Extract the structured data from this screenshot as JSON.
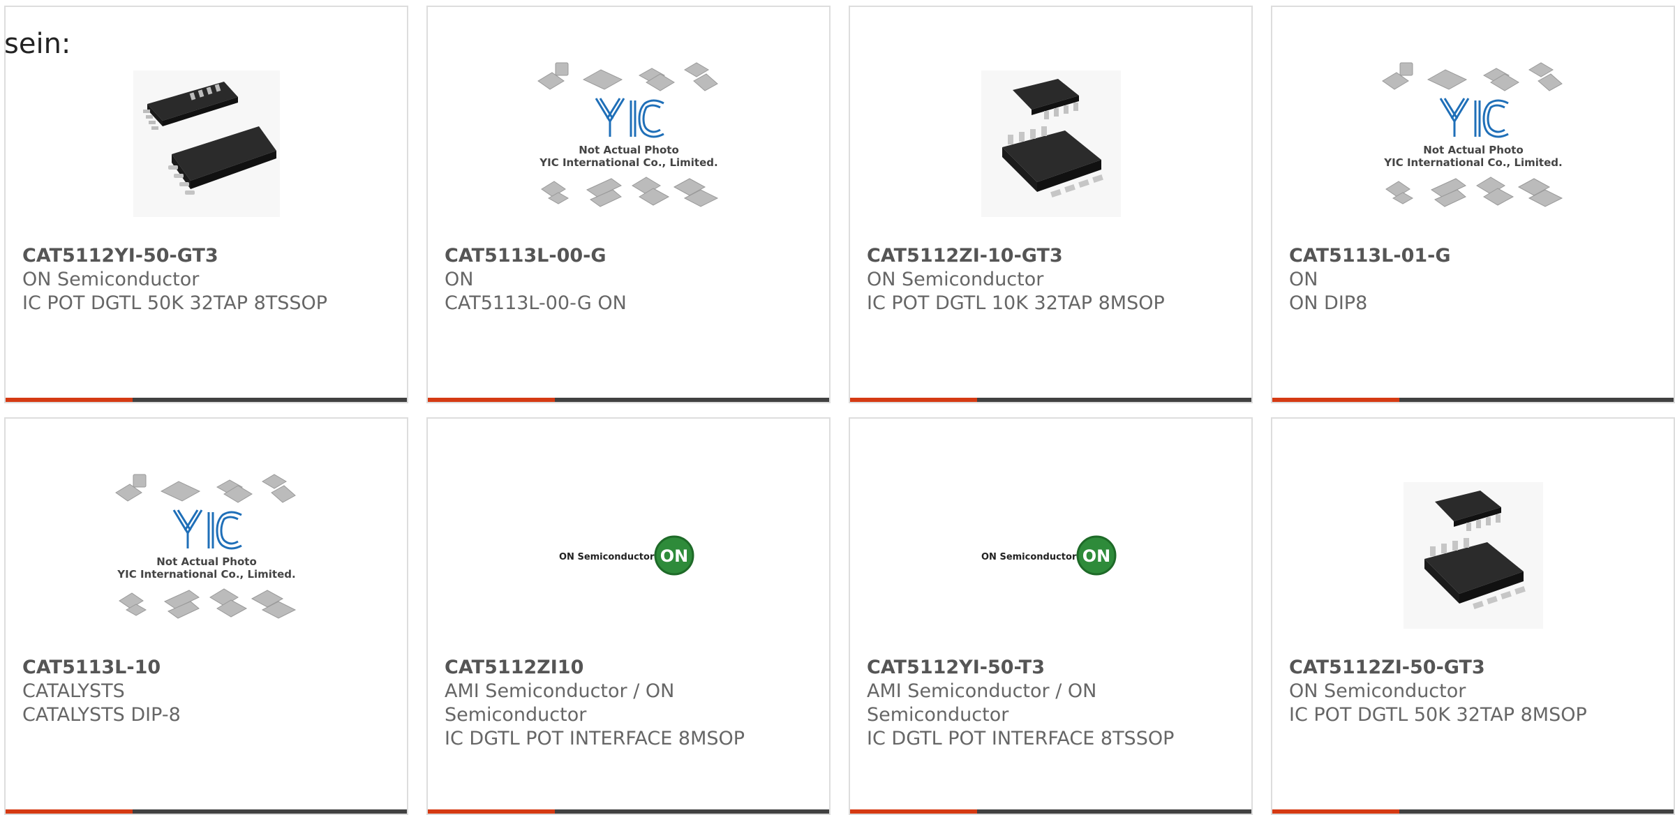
{
  "intro_text": "sein:",
  "products": [
    {
      "part": "CAT5112YI-50-GT3",
      "maker": "ON Semiconductor",
      "desc": "IC POT DGTL 50K 32TAP 8TSSOP",
      "image": "chip-tssop"
    },
    {
      "part": "CAT5113L-00-G",
      "maker": "ON",
      "desc": "CAT5113L-00-G ON",
      "image": "yic-placeholder"
    },
    {
      "part": "CAT5112ZI-10-GT3",
      "maker": "ON Semiconductor",
      "desc": "IC POT DGTL 10K 32TAP 8MSOP",
      "image": "chip-msop"
    },
    {
      "part": "CAT5113L-01-G",
      "maker": "ON",
      "desc": "ON DIP8",
      "image": "yic-placeholder"
    },
    {
      "part": "CAT5113L-10",
      "maker": "CATALYSTS",
      "desc": "CATALYSTS DIP-8",
      "image": "yic-placeholder"
    },
    {
      "part": "CAT5112ZI10",
      "maker": "AMI Semiconductor / ON Semiconductor",
      "desc": "IC DGTL POT INTERFACE 8MSOP",
      "image": "on-logo"
    },
    {
      "part": "CAT5112YI-50-T3",
      "maker": "AMI Semiconductor / ON Semiconductor",
      "desc": "IC DGTL POT INTERFACE 8TSSOP",
      "image": "on-logo"
    },
    {
      "part": "CAT5112ZI-50-GT3",
      "maker": "ON Semiconductor",
      "desc": "IC POT DGTL 50K 32TAP 8MSOP",
      "image": "chip-msop"
    }
  ],
  "placeholder": {
    "line1": "Not Actual Photo",
    "line2": "YIC International Co., Limited.",
    "logo": "YIC"
  },
  "onlogo": {
    "company": "ON Semiconductor",
    "mark": "ON"
  },
  "colors": {
    "accent": "#d53a13",
    "bar_dark": "#414141",
    "text": "#666666",
    "border": "#dddddd",
    "on_green": "#2e8b3a",
    "yic_blue": "#1f6fb8"
  }
}
